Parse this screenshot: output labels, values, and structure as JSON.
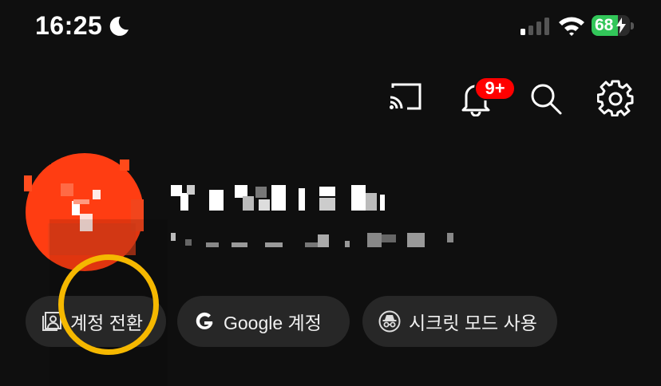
{
  "status_bar": {
    "time": "16:25",
    "battery_level": "68",
    "battery_fraction": 0.68,
    "icons": [
      "moon-icon",
      "cellular-signal-icon",
      "wifi-icon",
      "battery-charging-icon"
    ]
  },
  "toolbar": {
    "notification_badge": "9+",
    "icons": [
      "cast-icon",
      "bell-icon",
      "search-icon",
      "settings-gear-icon"
    ]
  },
  "profile": {
    "avatar_letter": "V",
    "avatar_color": "#ff3d12",
    "name_redacted": true,
    "handle_redacted": true
  },
  "chips": [
    {
      "label": "계정 전환",
      "icon": "switch-account-icon"
    },
    {
      "label": "Google 계정",
      "icon": "google-g-icon"
    },
    {
      "label": "시크릿 모드 사용",
      "icon": "incognito-icon"
    }
  ],
  "colors": {
    "background": "#0f0f0f",
    "chip_background": "#272727",
    "badge": "#ff0000",
    "highlight_annotation": "#f5b800",
    "battery_fill": "#32c659"
  }
}
